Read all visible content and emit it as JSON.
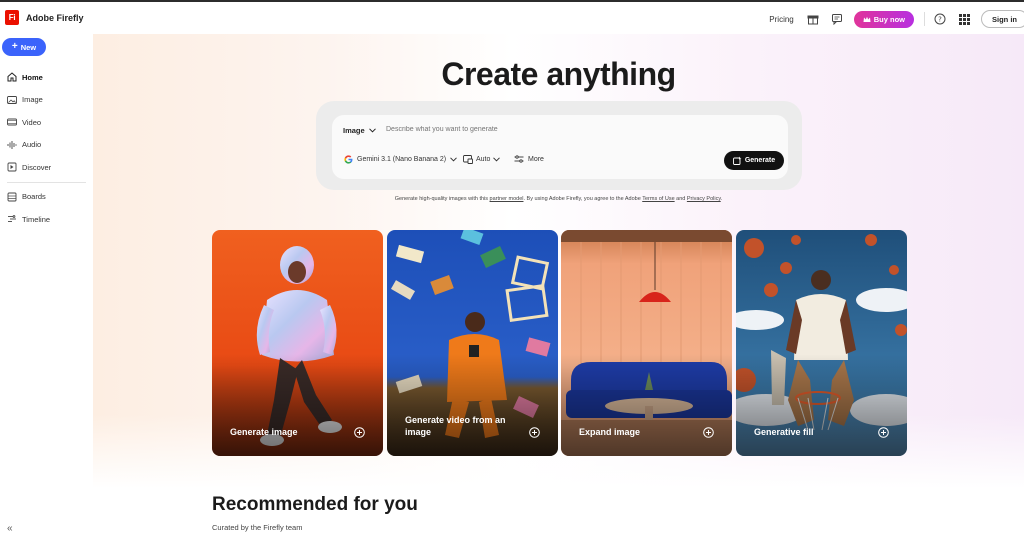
{
  "app": {
    "logo_text": "Fi",
    "brand_name": "Adobe Firefly"
  },
  "header": {
    "pricing": "Pricing",
    "buy_now": "Buy now",
    "sign_in": "Sign in",
    "icons": [
      "gift-icon",
      "chat-icon",
      "crown-icon",
      "help-icon",
      "apps-grid-icon"
    ]
  },
  "sidebar": {
    "new_label": "New",
    "items": [
      {
        "label": "Home",
        "icon": "home-icon",
        "active": true
      },
      {
        "label": "Image",
        "icon": "image-icon"
      },
      {
        "label": "Video",
        "icon": "video-icon"
      },
      {
        "label": "Audio",
        "icon": "audio-icon"
      },
      {
        "label": "Discover",
        "icon": "discover-icon"
      },
      {
        "label": "Boards",
        "icon": "boards-icon"
      },
      {
        "label": "Timeline",
        "icon": "timeline-icon"
      }
    ],
    "collapse_icon": "«"
  },
  "hero": {
    "title": "Create anything"
  },
  "prompt": {
    "type_label": "Image",
    "placeholder": "Describe what you want to generate",
    "model": "Gemini 3.1 (Nano Banana 2)",
    "aspect": "Auto",
    "more": "More",
    "generate": "Generate"
  },
  "disclaimer": {
    "part1": "Generate high-quality images with this ",
    "link1": "partner model",
    "part2": ". By using Adobe Firefly, you agree to the Adobe ",
    "link2": "Terms of Use",
    "part3": " and ",
    "link3": "Privacy Policy",
    "part4": "."
  },
  "cards": [
    {
      "label": "Generate image"
    },
    {
      "label": "Generate video from an image"
    },
    {
      "label": "Expand image"
    },
    {
      "label": "Generative fill"
    }
  ],
  "recommended": {
    "title": "Recommended for you",
    "subtitle": "Curated by the Firefly team"
  },
  "colors": {
    "new_button": "#3b63fb",
    "logo_red": "#eb1000",
    "buy_gradient_start": "#e0349a",
    "buy_gradient_end": "#b72fe0",
    "generate_button": "#111111"
  }
}
